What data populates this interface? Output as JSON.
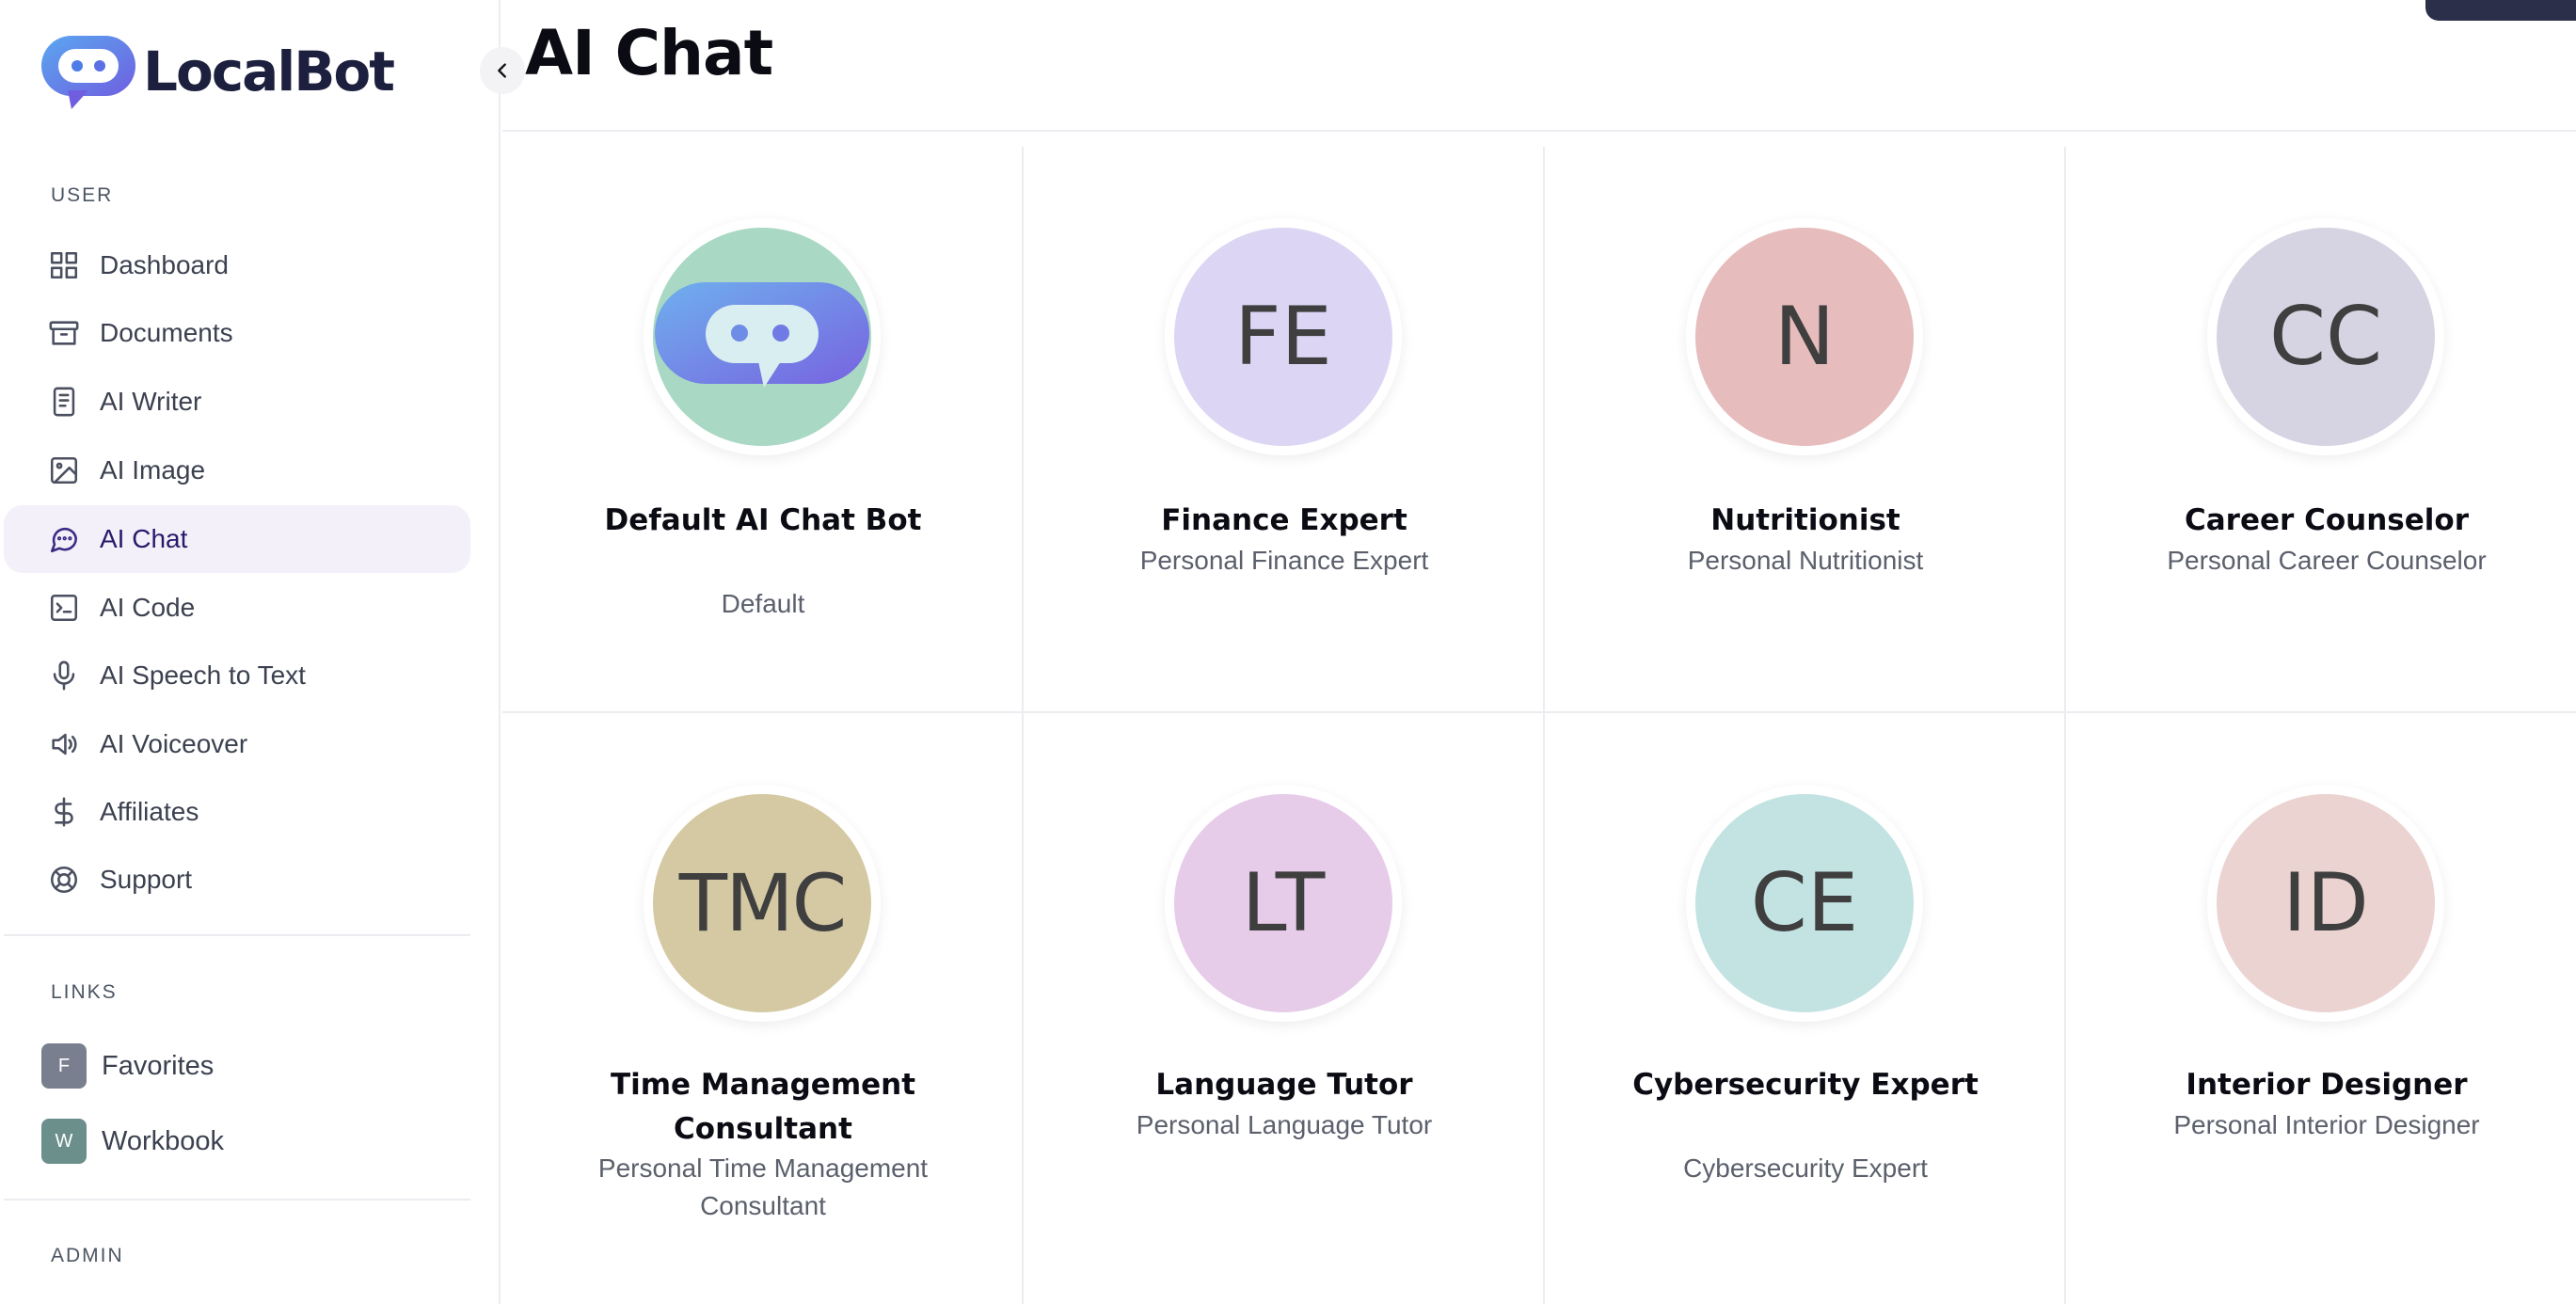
{
  "brand": {
    "name": "LocalBot"
  },
  "page": {
    "title": "AI Chat"
  },
  "sidebar": {
    "user_label": "USER",
    "items": [
      {
        "label": "Dashboard",
        "icon": "grid-icon"
      },
      {
        "label": "Documents",
        "icon": "archive-icon"
      },
      {
        "label": "AI Writer",
        "icon": "document-icon"
      },
      {
        "label": "AI Image",
        "icon": "image-icon"
      },
      {
        "label": "AI Chat",
        "icon": "chat-icon",
        "active": true
      },
      {
        "label": "AI Code",
        "icon": "terminal-icon"
      },
      {
        "label": "AI Speech to Text",
        "icon": "microphone-icon"
      },
      {
        "label": "AI Voiceover",
        "icon": "speaker-icon"
      },
      {
        "label": "Affiliates",
        "icon": "dollar-icon"
      },
      {
        "label": "Support",
        "icon": "lifebuoy-icon"
      }
    ],
    "links_label": "LINKS",
    "links": [
      {
        "badge": "F",
        "label": "Favorites",
        "color": "#7a7f8f"
      },
      {
        "badge": "W",
        "label": "Workbook",
        "color": "#6b8f8a"
      }
    ],
    "admin_label": "ADMIN"
  },
  "bots": [
    {
      "initials": "",
      "name": "Default AI Chat Bot",
      "desc": "Default",
      "color": "#a9d8c4"
    },
    {
      "initials": "FE",
      "name": "Finance Expert",
      "desc": "Personal Finance Expert",
      "color": "#dcd6f4"
    },
    {
      "initials": "N",
      "name": "Nutritionist",
      "desc": "Personal Nutritionist",
      "color": "#e6bcbd"
    },
    {
      "initials": "CC",
      "name": "Career Counselor",
      "desc": "Personal Career Counselor",
      "color": "#d6d4e2"
    },
    {
      "initials": "TMC",
      "name": "Time Management Consultant",
      "desc": "Personal Time Management Consultant",
      "color": "#d5c9a4"
    },
    {
      "initials": "LT",
      "name": "Language Tutor",
      "desc": "Personal Language Tutor",
      "color": "#e6cce9"
    },
    {
      "initials": "CE",
      "name": "Cybersecurity Expert",
      "desc": "Cybersecurity Expert",
      "color": "#c3e3e2"
    },
    {
      "initials": "ID",
      "name": "Interior Designer",
      "desc": "Personal Interior Designer",
      "color": "#ebd3d2"
    }
  ]
}
